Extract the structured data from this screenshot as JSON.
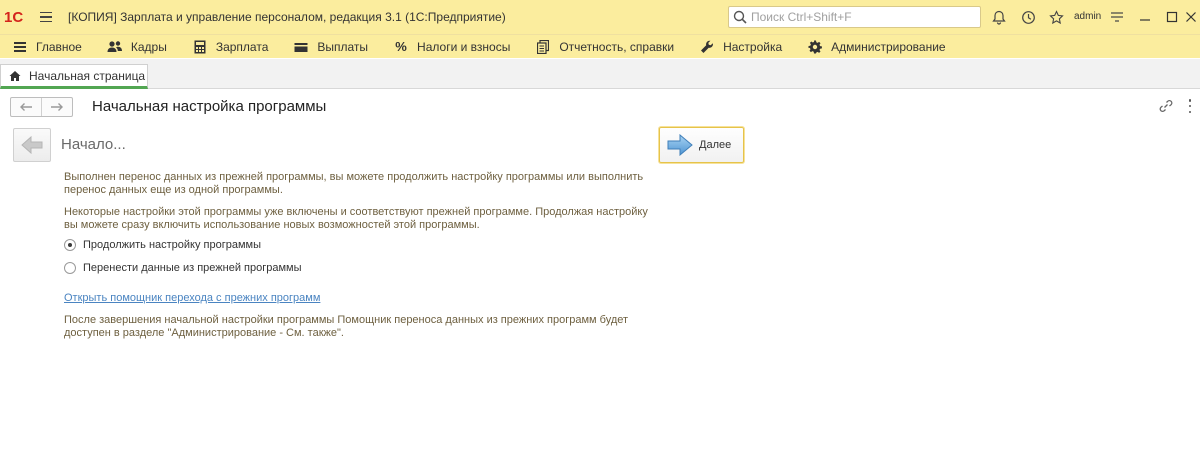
{
  "titlebar": {
    "logo": "1С",
    "title": "[КОПИЯ] Зарплата и управление персоналом, редакция 3.1  (1С:Предприятие)",
    "search_placeholder": "Поиск Ctrl+Shift+F",
    "user": "admin"
  },
  "menu": {
    "items": [
      {
        "label": "Главное",
        "icon": "hamburger-icon"
      },
      {
        "label": "Кадры",
        "icon": "people-icon"
      },
      {
        "label": "Зарплата",
        "icon": "calculator-icon"
      },
      {
        "label": "Выплаты",
        "icon": "wallet-icon"
      },
      {
        "label": "Налоги и взносы",
        "icon": "percent-icon"
      },
      {
        "label": "Отчетность, справки",
        "icon": "documents-icon"
      },
      {
        "label": "Настройка",
        "icon": "wrench-icon"
      },
      {
        "label": "Администрирование",
        "icon": "gear-icon"
      }
    ]
  },
  "tabs": {
    "home": "Начальная страница"
  },
  "form": {
    "title": "Начальная настройка программы",
    "step_title": "Начало...",
    "next_label": "Далее",
    "para1": "Выполнен перенос данных из прежней программы, вы можете продолжить настройку программы или выполнить перенос данных еще из одной программы.",
    "para2": "Некоторые настройки этой программы уже включены и соответствуют прежней программе. Продолжая настройку вы можете сразу включить использование новых возможностей этой программы.",
    "options": [
      {
        "label": "Продолжить настройку программы",
        "selected": true
      },
      {
        "label": "Перенести данные из прежней программы",
        "selected": false
      }
    ],
    "link": "Открыть помощник перехода с прежних программ",
    "para3": "После завершения начальной настройки программы Помощник переноса данных из прежних программ будет доступен в разделе \"Администрирование - См. также\"."
  }
}
